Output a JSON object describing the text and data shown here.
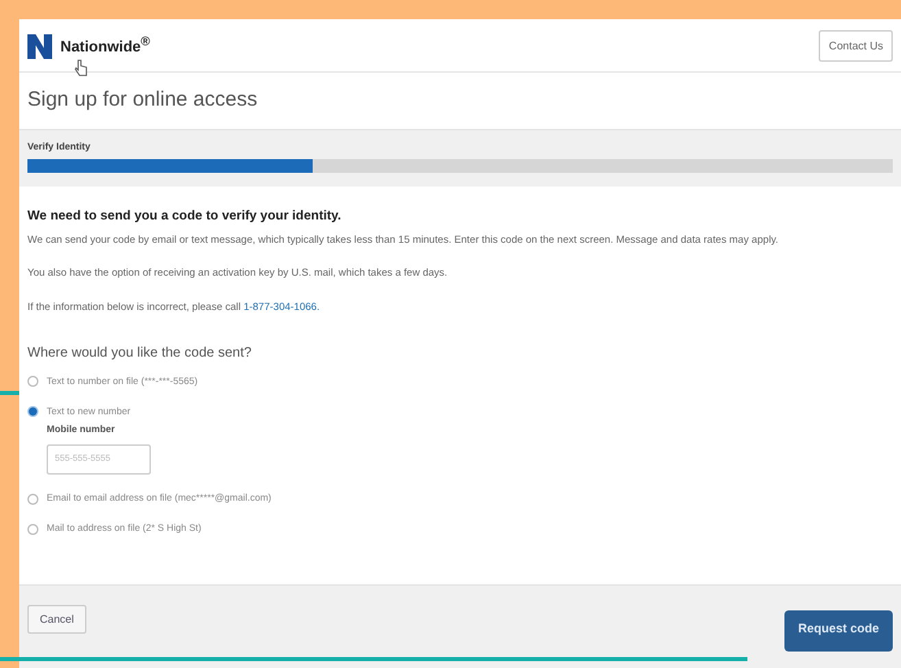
{
  "header": {
    "logo_text": "Nationwide$^{®}$",
    "contact_button": "Contact Us"
  },
  "page_title": "Sign up for online access",
  "progress": {
    "label": "Verify Identity",
    "level": 0.33
  },
  "content": {
    "heading": "We need to send you a code to verify your identity.",
    "paragraphs": [
      "We can send your code by email or text message, which typically takes less than 15 minutes. Enter this code on the next screen. Message and data rates may apply.",
      "You also have the option of receiving an activation key by U.S. mail, which takes a few days."
    ],
    "call_text": "If the information below is incorrect, please call",
    "phone_link": "1-877-304-1066."
  },
  "question": "Where would you like the code sent?",
  "options": [
    {
      "label": "Text to number on file (***-***-5565)",
      "selected": false
    },
    {
      "label": "Text to new number",
      "selected": true,
      "field_label": "Mobile number",
      "placeholder": "555-555-5555"
    },
    {
      "label": "Email to email address on file (mec*****@gmail.com)",
      "selected": false
    },
    {
      "label": "Mail to address on file (2* S High St)",
      "selected": false
    }
  ],
  "footer": {
    "cancel": "Cancel",
    "submit": "Request code"
  }
}
